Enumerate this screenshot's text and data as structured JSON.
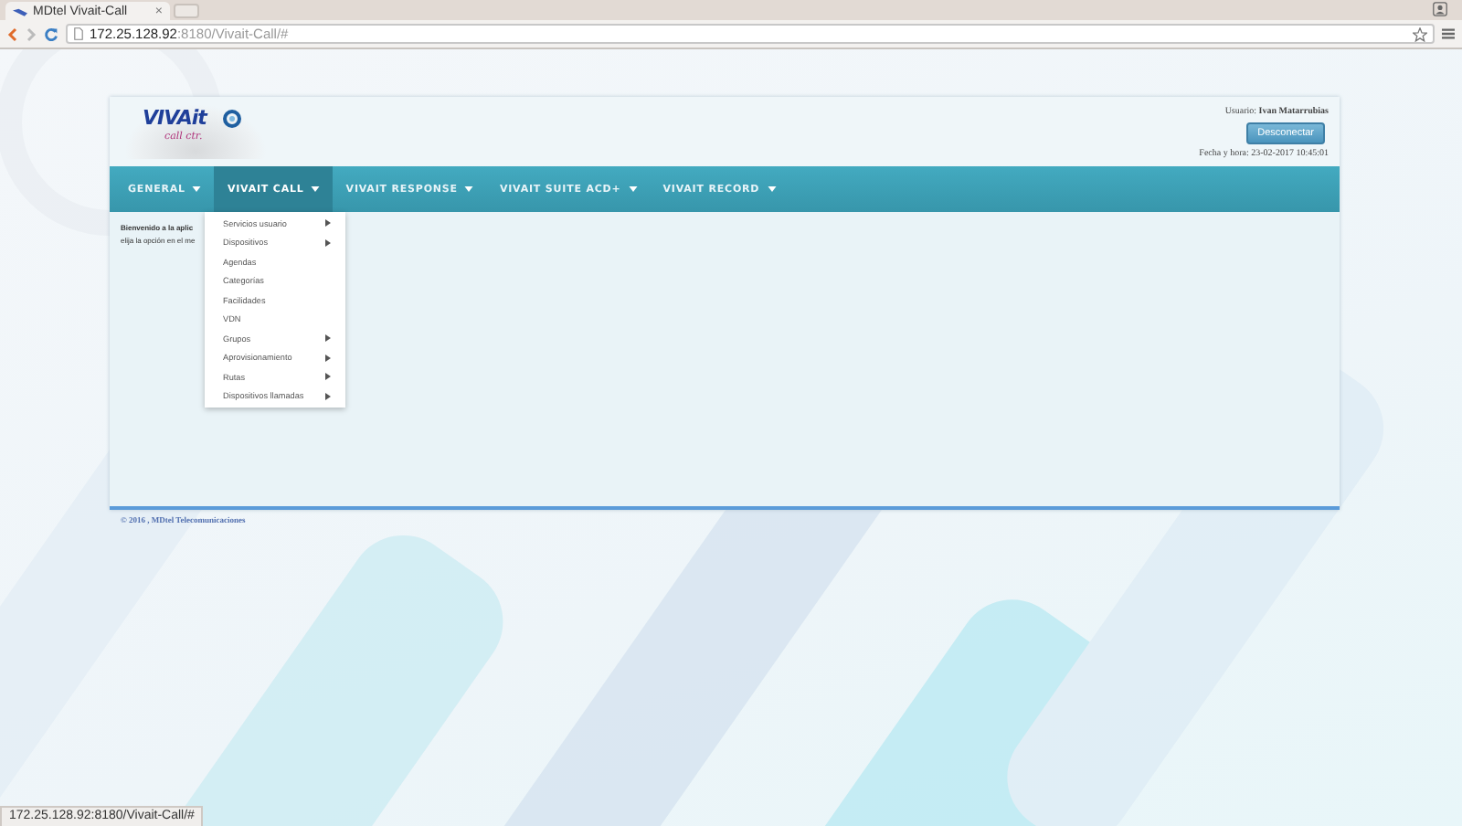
{
  "browser": {
    "tab_title": "MDtel Vivait-Call",
    "tab_close": "×",
    "url_host": "172.25.128.92",
    "url_rest": ":8180/Vivait-Call/#"
  },
  "header": {
    "logo_main": "VIVAit",
    "logo_sub": "call ctr.",
    "user_label": "Usuario:",
    "user_name": "Ivan Matarrubias",
    "logout_button": "Desconectar",
    "datetime": "Fecha y hora: 23-02-2017 10:45:01"
  },
  "nav": [
    {
      "label": "GENERAL",
      "selected": false
    },
    {
      "label": "VIVAIT CALL",
      "selected": true
    },
    {
      "label": "VIVAIT RESPONSE",
      "selected": false
    },
    {
      "label": "VIVAIT SUITE ACD+",
      "selected": false
    },
    {
      "label": "VIVAIT RECORD",
      "selected": false
    }
  ],
  "dropdown": [
    {
      "label": "Servicios usuario",
      "submenu": true
    },
    {
      "label": "Dispositivos",
      "submenu": true
    },
    {
      "label": "Agendas",
      "submenu": false
    },
    {
      "label": "Categorías",
      "submenu": false
    },
    {
      "label": "Facilidades",
      "submenu": false
    },
    {
      "label": "VDN",
      "submenu": false
    },
    {
      "label": "Grupos",
      "submenu": true
    },
    {
      "label": "Aprovisionamiento",
      "submenu": true
    },
    {
      "label": "Rutas",
      "submenu": true
    },
    {
      "label": "Dispositivos llamadas",
      "submenu": true
    }
  ],
  "welcome": {
    "title": "Bienvenido a la aplic",
    "text": "elija la opción en el me"
  },
  "footer": "© 2016 , MDtel Telecomunicaciones",
  "status_bar": "172.25.128.92:8180/Vivait-Call/#"
}
